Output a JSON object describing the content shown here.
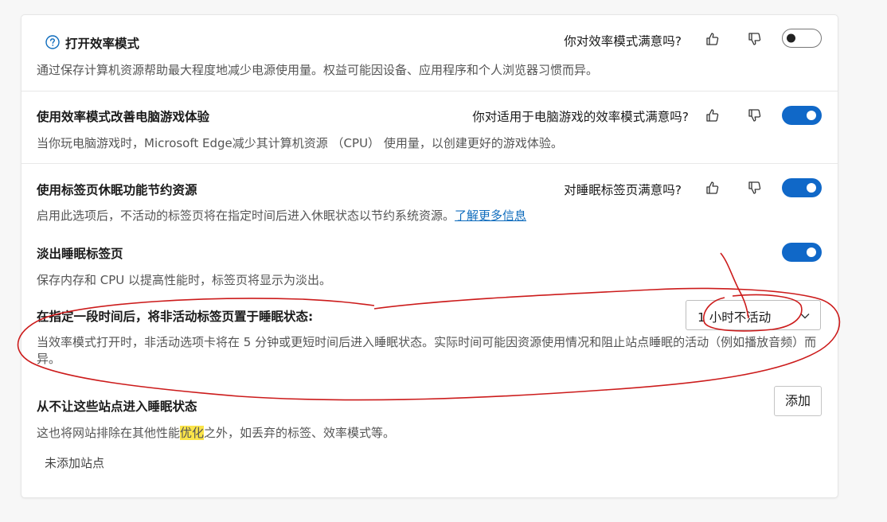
{
  "efficiency_mode": {
    "title": "打开效率模式",
    "description": "通过保存计算机资源帮助最大程度地减少电源使用量。权益可能因设备、应用程序和个人浏览器习惯而异。",
    "feedback_question": "你对效率模式满意吗?",
    "toggle_state": "off"
  },
  "gaming": {
    "title": "使用效率模式改善电脑游戏体验",
    "description": "当你玩电脑游戏时，Microsoft Edge减少其计算机资源 （CPU） 使用量，以创建更好的游戏体验。",
    "feedback_question": "你对适用于电脑游戏的效率模式满意吗?",
    "toggle_state": "on"
  },
  "sleeping_tabs": {
    "title": "使用标签页休眠功能节约资源",
    "description": "启用此选项后，不活动的标签页将在指定时间后进入休眠状态以节约系统资源。",
    "learn_more": "了解更多信息",
    "feedback_question": "对睡眠标签页满意吗?",
    "toggle_state": "on"
  },
  "fade_tabs": {
    "title": "淡出睡眠标签页",
    "description": "保存内存和 CPU 以提高性能时，标签页将显示为淡出。",
    "toggle_state": "on"
  },
  "sleep_after": {
    "title": "在指定一段时间后，将非活动标签页置于睡眠状态:",
    "description": "当效率模式打开时，非活动选项卡将在 5 分钟或更短时间后进入睡眠状态。实际时间可能因资源使用情况和阻止站点睡眠的活动（例如播放音频）而异。",
    "selected": "1 小时不活动"
  },
  "never_sleep": {
    "title": "从不让这些站点进入睡眠状态",
    "add_label": "添加",
    "desc_before": "这也将网站排除在其他性能",
    "desc_highlight": "优化",
    "desc_after": "之外，如丢弃的标签、效率模式等。",
    "empty": "未添加站点"
  },
  "icons": {
    "help": "help-circle-icon",
    "like": "thumbs-up-icon",
    "dislike": "thumbs-down-icon",
    "dropdown": "chevron-down-icon"
  },
  "colors": {
    "accent": "#1068c8",
    "link": "#0f6cbd",
    "annotation": "#cc1b1b",
    "highlight": "#fbe44a"
  }
}
